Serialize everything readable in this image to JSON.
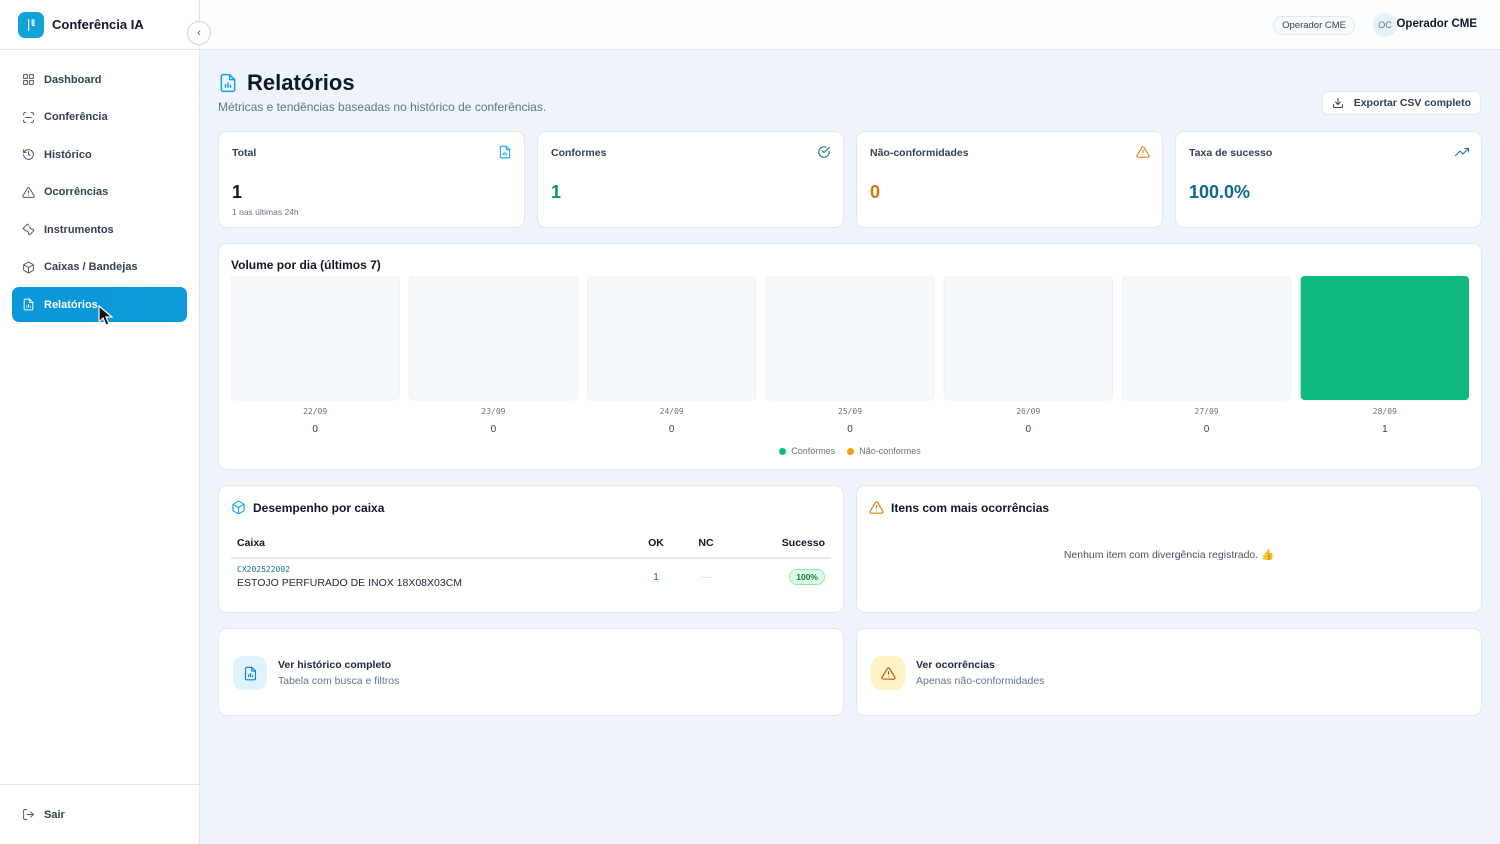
{
  "app": {
    "name": "Conferência IA"
  },
  "sidebar": {
    "items": [
      {
        "label": "Dashboard",
        "icon": "grid-icon"
      },
      {
        "label": "Conferência",
        "icon": "scan-icon"
      },
      {
        "label": "Histórico",
        "icon": "history-icon"
      },
      {
        "label": "Ocorrências",
        "icon": "warning-icon"
      },
      {
        "label": "Instrumentos",
        "icon": "wrench-icon"
      },
      {
        "label": "Caixas / Bandejas",
        "icon": "box-icon"
      },
      {
        "label": "Relatórios",
        "icon": "report-icon",
        "active": true
      }
    ],
    "logout_label": "Sair"
  },
  "topbar": {
    "role_badge": "Operador CME",
    "avatar_initials": "OC",
    "user_name": "Operador CME"
  },
  "page": {
    "title": "Relatórios",
    "subtitle": "Métricas e tendências baseadas no histórico de conferências.",
    "export_label": "Exportar CSV completo"
  },
  "stats": [
    {
      "label": "Total",
      "value": "1",
      "note": "1 nas últimas 24h",
      "color": "#0f172a",
      "icon": "file-icon",
      "icon_color": "#0ea5e9"
    },
    {
      "label": "Conformes",
      "value": "1",
      "note": "",
      "color": "#059669",
      "icon": "check-circle-icon",
      "icon_color": "#0f766e"
    },
    {
      "label": "Não-conformidades",
      "value": "0",
      "note": "",
      "color": "#d97706",
      "icon": "warning-icon",
      "icon_color": "#d97706"
    },
    {
      "label": "Taxa de sucesso",
      "value": "100.0%",
      "note": "",
      "color": "#0c6a8f",
      "icon": "trend-up-icon",
      "icon_color": "#0e7490"
    }
  ],
  "chart_title": "Volume por dia (últimos 7)",
  "chart_data": {
    "type": "bar",
    "title": "Volume por dia (últimos 7)",
    "categories": [
      "22/09",
      "23/09",
      "24/09",
      "25/09",
      "26/09",
      "27/09",
      "28/09"
    ],
    "series": [
      {
        "name": "Conformes",
        "values": [
          0,
          0,
          0,
          0,
          0,
          0,
          1
        ],
        "color": "#10b981"
      },
      {
        "name": "Não-conformes",
        "values": [
          0,
          0,
          0,
          0,
          0,
          0,
          0
        ],
        "color": "#f59e0b"
      }
    ],
    "totals": [
      0,
      0,
      0,
      0,
      0,
      0,
      1
    ],
    "legend": "bottom-center"
  },
  "performance": {
    "title": "Desempenho por caixa",
    "headers": {
      "box": "Caixa",
      "ok": "OK",
      "nc": "NC",
      "success": "Sucesso"
    },
    "rows": [
      {
        "code": "CX202522002",
        "name": "ESTOJO PERFURADO DE INOX 18X08X03CM",
        "ok": "1",
        "nc": "—",
        "success": "100%"
      }
    ]
  },
  "occurrences": {
    "title": "Itens com mais ocorrências",
    "empty_message": "Nenhum item com divergência registrado. 👍"
  },
  "links": [
    {
      "title": "Ver histórico completo",
      "subtitle": "Tabela com busca e filtros",
      "icon": "report-icon"
    },
    {
      "title": "Ver ocorrências",
      "subtitle": "Apenas não-conformidades",
      "icon": "warning-icon"
    }
  ]
}
